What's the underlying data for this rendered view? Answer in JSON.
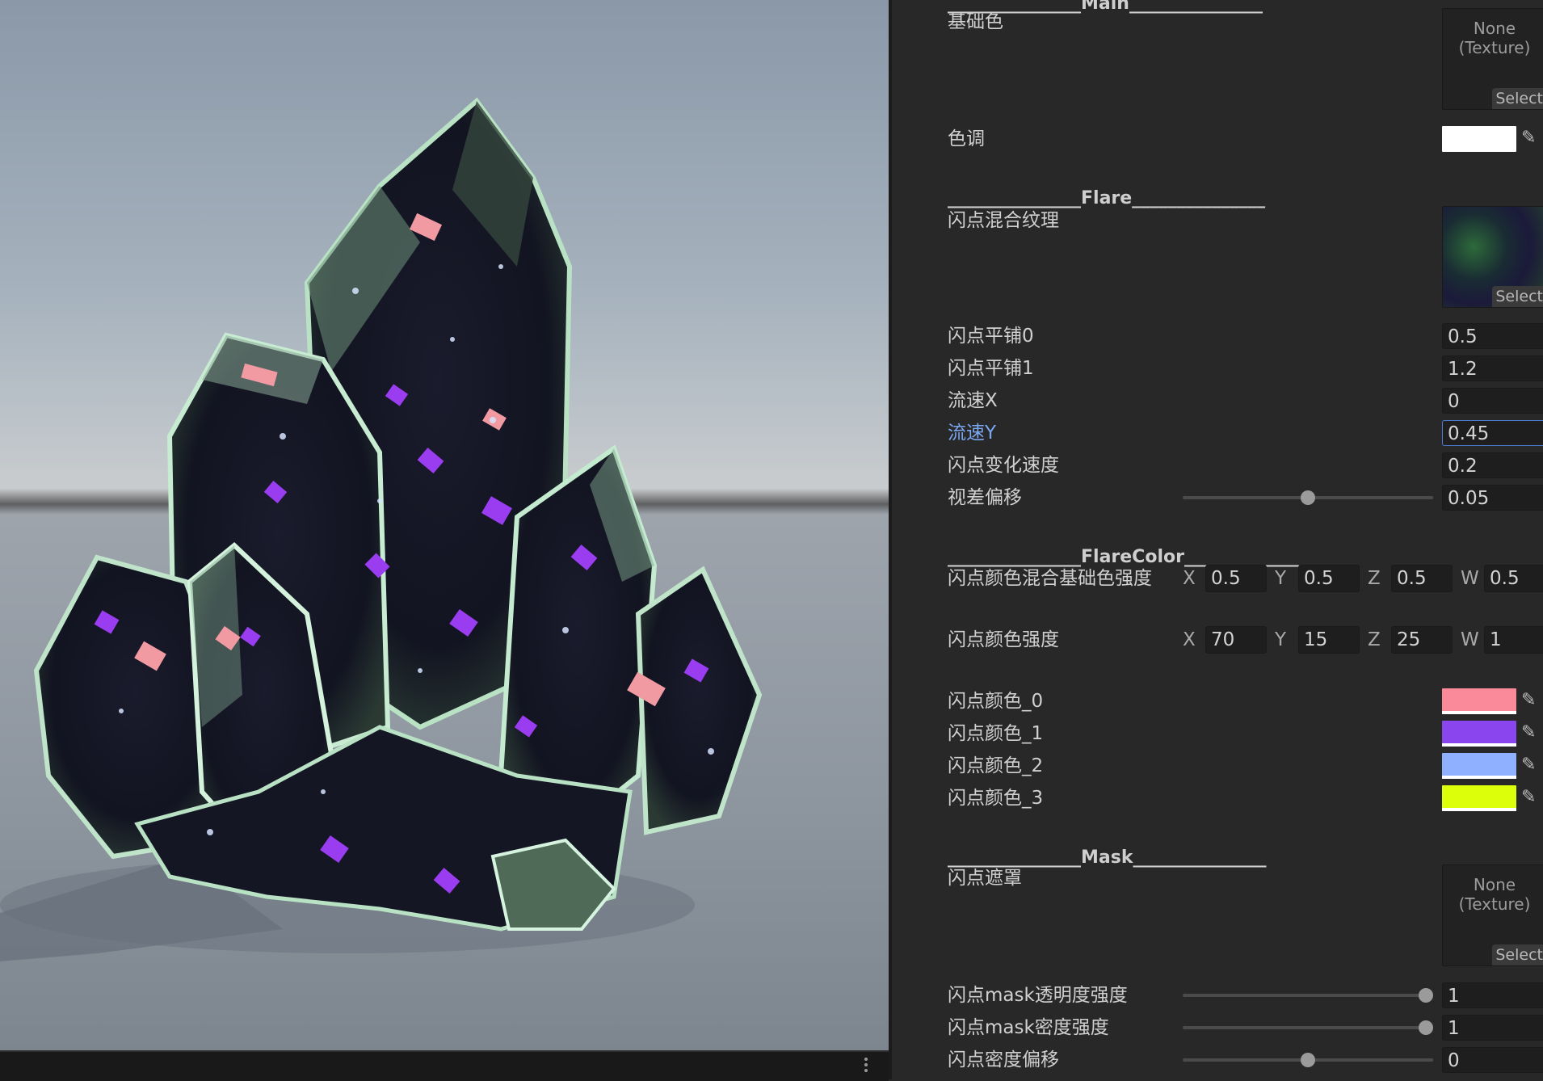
{
  "inspector": {
    "sections": {
      "main": "_______________Main_______________",
      "flare": "_______________Flare_______________",
      "flarecolor": "_______________FlareColor_______________",
      "mask": "_______________Mask_______________"
    },
    "base_color": {
      "label": "基础色",
      "texture": "None\n(Texture)",
      "select": "Select"
    },
    "tint": {
      "label": "色调",
      "color": "#ffffff"
    },
    "flare_texture": {
      "label": "闪点混合纹理",
      "select": "Select"
    },
    "props": [
      {
        "label": "闪点平铺0",
        "value": "0.5"
      },
      {
        "label": "闪点平铺1",
        "value": "1.2"
      },
      {
        "label": "流速X",
        "value": "0"
      },
      {
        "label": "流速Y",
        "value": "0.45"
      },
      {
        "label": "闪点变化速度",
        "value": "0.2"
      },
      {
        "label": "视差偏移",
        "value": "0.05",
        "slider": 0.5
      }
    ],
    "blend_strength": {
      "label": "闪点颜色混合基础色强度",
      "x": "0.5",
      "y": "0.5",
      "z": "0.5",
      "w": "0.5"
    },
    "color_strength": {
      "label": "闪点颜色强度",
      "x": "70",
      "y": "15",
      "z": "25",
      "w": "1"
    },
    "axis": {
      "x": "X",
      "y": "Y",
      "z": "Z",
      "w": "W"
    },
    "colors": [
      {
        "label": "闪点颜色_0",
        "color": "#fa8a9a"
      },
      {
        "label": "闪点颜色_1",
        "color": "#8a45ee"
      },
      {
        "label": "闪点颜色_2",
        "color": "#8fb0ff"
      },
      {
        "label": "闪点颜色_3",
        "color": "#dcff0a"
      }
    ],
    "mask_texture": {
      "label": "闪点遮罩",
      "texture": "None\n(Texture)",
      "select": "Select"
    },
    "mask_props": [
      {
        "label": "闪点mask透明度强度",
        "value": "1",
        "slider": 1.0
      },
      {
        "label": "闪点mask密度强度",
        "value": "1",
        "slider": 1.0
      },
      {
        "label": "闪点密度偏移",
        "value": "0",
        "slider": 0.5
      }
    ]
  },
  "colors": {
    "panel": "#282828",
    "field": "#1e1e1e",
    "focus": "#4c7bd0",
    "label": "#d0d0d0",
    "focus_label": "#7aa7f0"
  }
}
